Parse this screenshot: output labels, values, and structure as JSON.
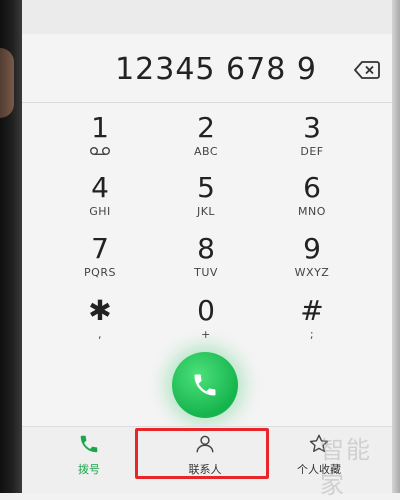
{
  "dialer": {
    "number": "12345 678 9",
    "keys": [
      {
        "digit": "1",
        "letters": ""
      },
      {
        "digit": "2",
        "letters": "ABC"
      },
      {
        "digit": "3",
        "letters": "DEF"
      },
      {
        "digit": "4",
        "letters": "GHI"
      },
      {
        "digit": "5",
        "letters": "JKL"
      },
      {
        "digit": "6",
        "letters": "MNO"
      },
      {
        "digit": "7",
        "letters": "PQRS"
      },
      {
        "digit": "8",
        "letters": "TUV"
      },
      {
        "digit": "9",
        "letters": "WXYZ"
      },
      {
        "digit": "✱",
        "letters": ","
      },
      {
        "digit": "0",
        "letters": "+"
      },
      {
        "digit": "#",
        "letters": ";"
      }
    ]
  },
  "nav": {
    "dial_label": "拨号",
    "contacts_label": "联系人",
    "favorites_label": "个人收藏"
  },
  "watermark": "智能家",
  "colors": {
    "call_green": "#16b44d",
    "highlight_red": "#e8262a"
  },
  "icons": {
    "backspace": "backspace-icon",
    "voicemail": "voicemail-icon",
    "call": "phone-icon",
    "contacts": "person-icon",
    "favorites": "star-icon"
  }
}
